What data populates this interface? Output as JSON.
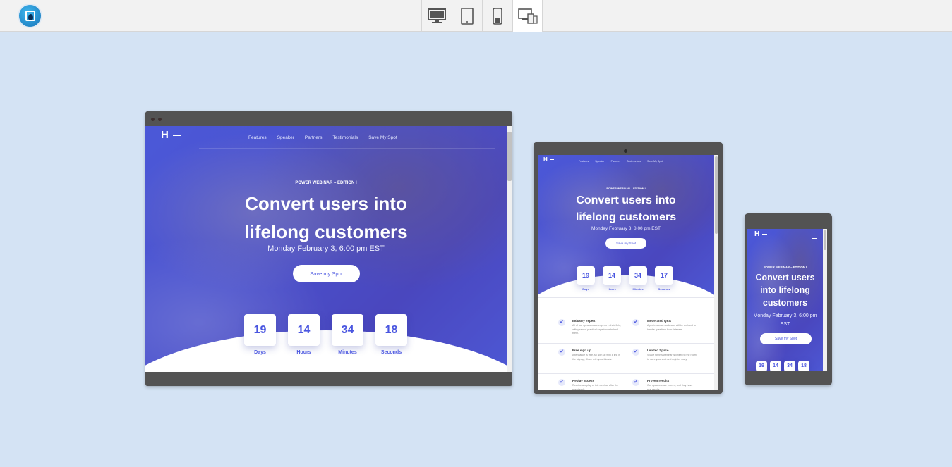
{
  "devices": {
    "desktop_icon": "desktop-icon",
    "tablet_icon": "tablet-icon",
    "mobile_icon": "mobile-icon",
    "responsive_icon": "responsive-icon"
  },
  "page": {
    "brand": "H",
    "nav": [
      "Features",
      "Speaker",
      "Partners",
      "Testimonials",
      "Save My Spot"
    ],
    "eyebrow": "POWER WEBINAR – EDITION I",
    "headline_line1": "Convert users into",
    "headline_line2": "lifelong customers",
    "date": "Monday February 3, 6:00 pm EST",
    "cta": "Save my Spot",
    "countdown": [
      {
        "value": "19",
        "label": "Days"
      },
      {
        "value": "14",
        "label": "Hours"
      },
      {
        "value": "34",
        "label": "Minutes"
      },
      {
        "value": "18",
        "label": "Seconds"
      }
    ]
  },
  "tablet": {
    "date": "Monday February 3, 8:00 pm EST",
    "countdown": [
      {
        "value": "19",
        "label": "Days"
      },
      {
        "value": "14",
        "label": "Hours"
      },
      {
        "value": "34",
        "label": "Minutes"
      },
      {
        "value": "17",
        "label": "Seconds"
      }
    ],
    "features": [
      {
        "title": "Industry expert",
        "text": "All of our speakers are experts in their field, with years of practical experience behind them."
      },
      {
        "title": "Moderated Q&A",
        "text": "A professional moderator will be on hand to handle questions from listeners."
      },
      {
        "title": "Free sign up",
        "text": "Attendance is free, so sign up with a link in the signup, Share with your friends."
      },
      {
        "title": "Limited Space",
        "text": "Space for this webinar is limited to the room to save your spot and register early."
      },
      {
        "title": "Replay access",
        "text": "Receive a replay of this webinar after the event ends."
      },
      {
        "title": "Proven results",
        "text": "Our speakers are proven, and they have real results."
      }
    ]
  },
  "phone": {
    "headline_line1": "Convert users",
    "headline_line2": "into lifelong",
    "headline_line3": "customers",
    "date_line1": "Monday February 3, 6:00 pm",
    "date_line2": "EST",
    "countdown": [
      "19",
      "14",
      "34",
      "18"
    ]
  }
}
